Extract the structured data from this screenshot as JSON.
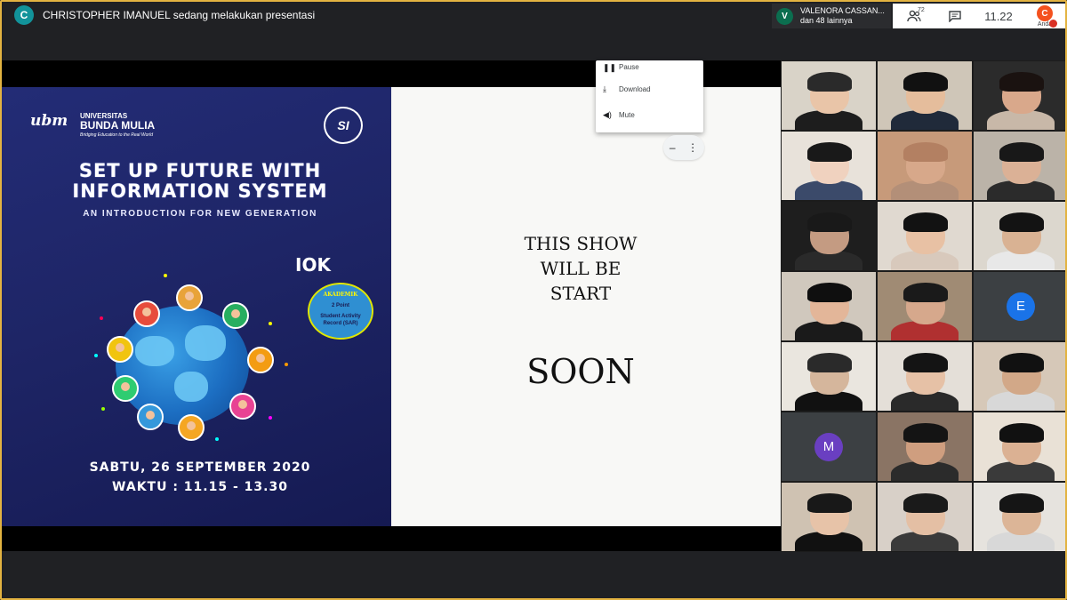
{
  "presenter": {
    "initial": "C",
    "text": "CHRISTOPHER IMANUEL sedang melakukan presentasi"
  },
  "viewers": {
    "initial": "V",
    "name": "VALENORA CASSAN...",
    "others": "dan 48 lainnya"
  },
  "tray": {
    "people_icon": "people-icon",
    "people_count": "72",
    "chat_icon": "chat-icon",
    "time": "11.22",
    "me_initial": "C",
    "me_label": "Anda"
  },
  "poster": {
    "logo_mark": "ubm",
    "university_line1": "UNIVERSITAS",
    "university_line2": "BUNDA MULIA",
    "tagline": "Bridging Education to the Real World",
    "program_logo": "SI",
    "title_line1": "SET UP FUTURE WITH",
    "title_line2": "INFORMATION SYSTEM",
    "subtitle": "AN INTRODUCTION FOR NEW GENERATION",
    "iok": "IOK",
    "badge_line1": "AKADEMIK",
    "badge_line2": "2 Point",
    "badge_line3": "Student Activity Record (SAR)",
    "date": "SABTU, 26 SEPTEMBER 2020",
    "time": "WAKTU : 11.15 - 13.30"
  },
  "slide": {
    "line1": "THIS SHOW",
    "line2": "WILL BE",
    "line3": "START",
    "line4": "SOON"
  },
  "menu": {
    "items": [
      {
        "icon": "pause-icon",
        "glyph": "❚❚",
        "label": "Pause"
      },
      {
        "icon": "download-icon",
        "glyph": "⤓",
        "label": "Download"
      },
      {
        "icon": "volume-icon",
        "glyph": "◀)",
        "label": "Mute"
      }
    ]
  },
  "mini_controls": {
    "minimize_glyph": "–",
    "more_glyph": "⋮"
  },
  "participants": {
    "letter_tiles": [
      {
        "initial": "E",
        "color": "#1a73e8"
      },
      {
        "initial": "M",
        "color": "#6a3fc1"
      }
    ]
  }
}
